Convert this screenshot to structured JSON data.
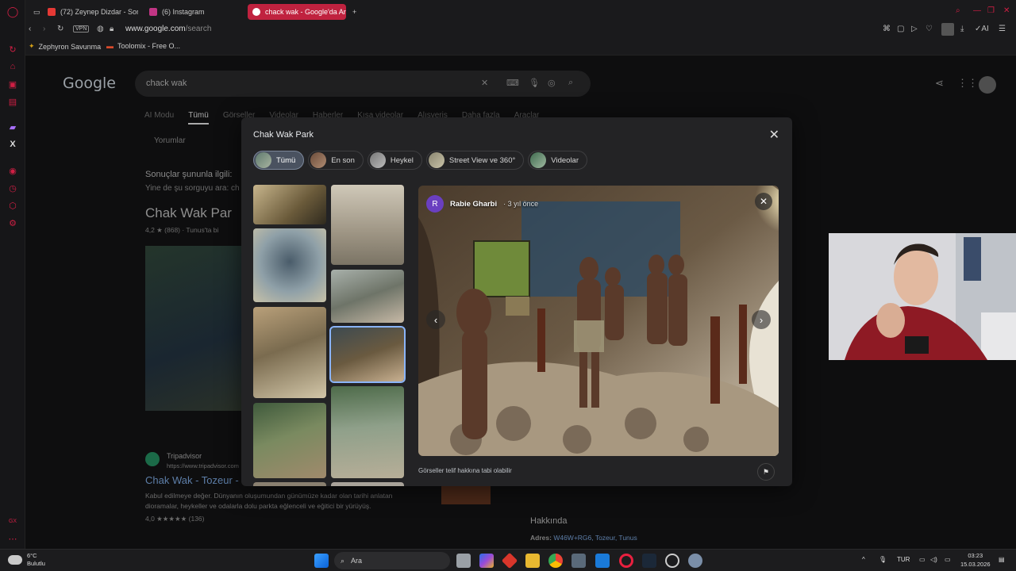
{
  "browser": {
    "tabs": [
      {
        "label": "(72) Zeynep Dizdar - Son",
        "color": "#e53935"
      },
      {
        "label": "(6) Instagram",
        "color": "#c13584"
      },
      {
        "label": "chack wak - Google'da Ar",
        "color": "#ffffff"
      }
    ],
    "new_tab": "+",
    "vpn": "VPN",
    "url_host": "www.google.com",
    "url_path": "/search",
    "ai_label": "AI",
    "bookmarks": [
      {
        "label": "Zephyron Savunma"
      },
      {
        "label": "Toolomix - Free O..."
      }
    ]
  },
  "google": {
    "logo": "Google",
    "query": "chack wak",
    "tabs": [
      "AI Modu",
      "Tümü",
      "Görseller",
      "Videolar",
      "Haberler",
      "Kısa videolar",
      "Alışveriş",
      "Daha fazla",
      "Araçlar"
    ],
    "active_tab": "Tümü",
    "yorumlar": "Yorumlar",
    "did_you_mean": "Sonuçlar şununla ilgili:",
    "search_instead": "Yine de şu sorguyu ara: ch",
    "kp_title": "Chak Wak Par",
    "kp_rating": "4,2 ★  (868) · Tunus'ta bi",
    "result_site": "Tripadvisor",
    "result_url": "https://www.tripadvisor.com",
    "result_title": "Chak Wak - Tozeur -",
    "result_snippet_1": "Kabul edilmeye değer. Dünyanın oluşumundan günümüze kadar olan tarihi anlatan",
    "result_snippet_2": "dioramalar, heykeller ve odalarla dolu parkta eğlenceli ve eğitici bir yürüyüş.",
    "result_rating": "4,0 ★★★★★ (136)",
    "about_title": "Hakkında",
    "address_label": "Adres:",
    "address_value": "W46W+RG6, Tozeur, Tunus"
  },
  "modal": {
    "title": "Chak Wak Park",
    "close": "✕",
    "chips": [
      {
        "label": "Tümü",
        "active": true
      },
      {
        "label": "En son",
        "active": false
      },
      {
        "label": "Heykel",
        "active": false
      },
      {
        "label": "Street View ve 360°",
        "active": false
      },
      {
        "label": "Videolar",
        "active": false
      }
    ],
    "uploader_initial": "R",
    "uploader_name": "Rabie Gharbi",
    "uploader_time": "· 3 yıl önce",
    "prev": "‹",
    "next": "›",
    "copyright": "Görseller telif hakkına tabi olabilir",
    "flag": "⚑"
  },
  "taskbar": {
    "temperature": "6°C",
    "weather": "Bulutlu",
    "search_placeholder": "Ara",
    "language": "TUR",
    "time": "03:23",
    "date": "15.03.2026"
  },
  "colors": {
    "accent": "#c0223f",
    "chip_active": "#4a5260",
    "selected_outline": "#8ab4f8"
  }
}
